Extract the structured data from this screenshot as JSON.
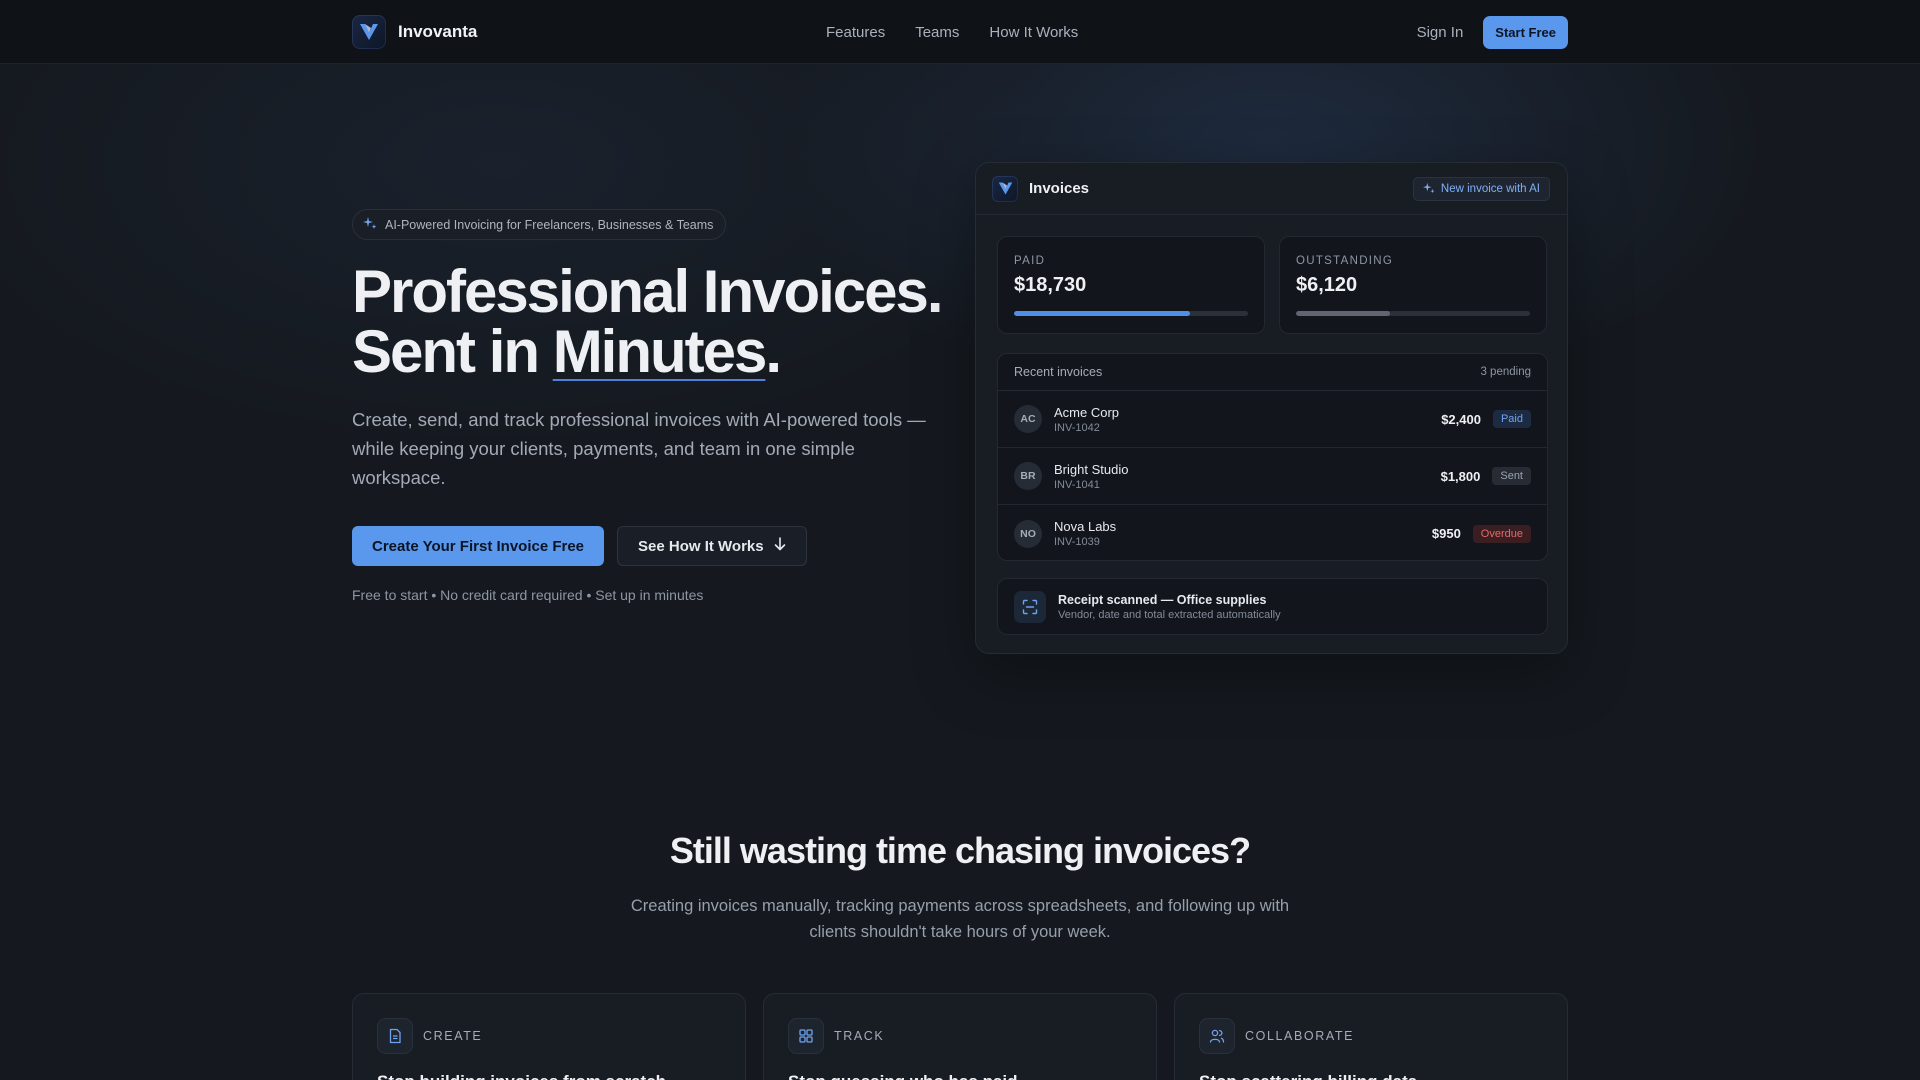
{
  "nav": {
    "brand": "Invovanta",
    "links": [
      "Features",
      "Teams",
      "How It Works"
    ],
    "signin": "Sign In",
    "start": "Start Free"
  },
  "hero": {
    "pill": "AI-Powered Invoicing for Freelancers, Businesses & Teams",
    "title_line1": "Professional Invoices.",
    "title_line2_prefix": "Sent in ",
    "title_line2_emph": "Minutes",
    "title_line2_suffix": ".",
    "subtitle": "Create, send, and track professional invoices with AI-powered tools — while keeping your clients, payments, and team in one simple workspace.",
    "cta_primary": "Create Your First Invoice Free",
    "cta_secondary": "See How It Works",
    "fine_print": "Free to start • No credit card required • Set up in minutes"
  },
  "invoice_card": {
    "title": "Invoices",
    "ai_button": "New invoice with AI",
    "stats": [
      {
        "label": "PAID",
        "value": "$18,730",
        "progress": 0.75,
        "color": "#4f8fe8"
      },
      {
        "label": "OUTSTANDING",
        "value": "$6,120",
        "progress": 0.4,
        "color": "#5f6672"
      }
    ],
    "recent": {
      "title": "Recent invoices",
      "pending": "3 pending",
      "rows": [
        {
          "initials": "AC",
          "client": "Acme Corp",
          "id": "INV-1042",
          "amount": "$2,400",
          "status": "Paid"
        },
        {
          "initials": "BR",
          "client": "Bright Studio",
          "id": "INV-1041",
          "amount": "$1,800",
          "status": "Sent"
        },
        {
          "initials": "NO",
          "client": "Nova Labs",
          "id": "INV-1039",
          "amount": "$950",
          "status": "Overdue"
        }
      ]
    },
    "receipt": {
      "title": "Receipt scanned — Office supplies",
      "subtitle": "Vendor, date and total extracted automatically"
    }
  },
  "problem": {
    "title": "Still wasting time chasing invoices?",
    "subtitle": "Creating invoices manually, tracking payments across spreadsheets, and following up with clients shouldn't take hours of your week."
  },
  "features": [
    {
      "label": "CREATE",
      "icon": "document-icon",
      "heading": "Stop building invoices from scratch"
    },
    {
      "label": "TRACK",
      "icon": "grid-icon",
      "heading": "Stop guessing who has paid"
    },
    {
      "label": "COLLABORATE",
      "icon": "users-icon",
      "heading": "Stop scattering billing data"
    }
  ],
  "colors": {
    "accent": "#5a98ee",
    "background": "#15191f",
    "nav_background": "#0f1217",
    "paid_badge": "#6fa3ee",
    "overdue_badge": "#e36a6a"
  }
}
